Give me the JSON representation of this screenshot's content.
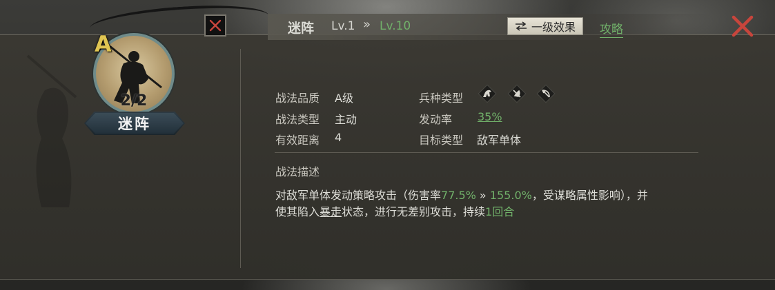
{
  "skill": {
    "name": "迷阵",
    "grade_letter": "A",
    "count": "2/2",
    "level_from": "Lv.1",
    "level_arrow": "»",
    "level_to": "Lv.10"
  },
  "header": {
    "effect_button": "一级效果",
    "effect_icon": "swap-arrows-icon",
    "strategy_link": "攻略"
  },
  "attributes": {
    "quality_label": "战法品质",
    "quality_value": "A级",
    "type_label": "战法类型",
    "type_value": "主动",
    "range_label": "有效距离",
    "range_value": "4",
    "troop_label": "兵种类型",
    "troop_icons": [
      "cavalry-icon",
      "shield-icon",
      "bow-icon"
    ],
    "rate_label": "发动率",
    "rate_value": "35%",
    "target_label": "目标类型",
    "target_value": "敌军单体"
  },
  "description": {
    "title": "战法描述",
    "part1": "对敌军单体发动策略攻击（伤害率",
    "dmg_from": "77.5%",
    "arrow": " » ",
    "dmg_to": "155.0%",
    "part2": "，受谋略属性影响），并",
    "part3": "使其陷入",
    "status": "暴走",
    "part4": "状态，进行无差别攻击，持续",
    "duration": "1回合"
  },
  "colors": {
    "accent_green": "#71b16a",
    "grade_gold": "#e0c552",
    "close_red": "#c8453c"
  }
}
